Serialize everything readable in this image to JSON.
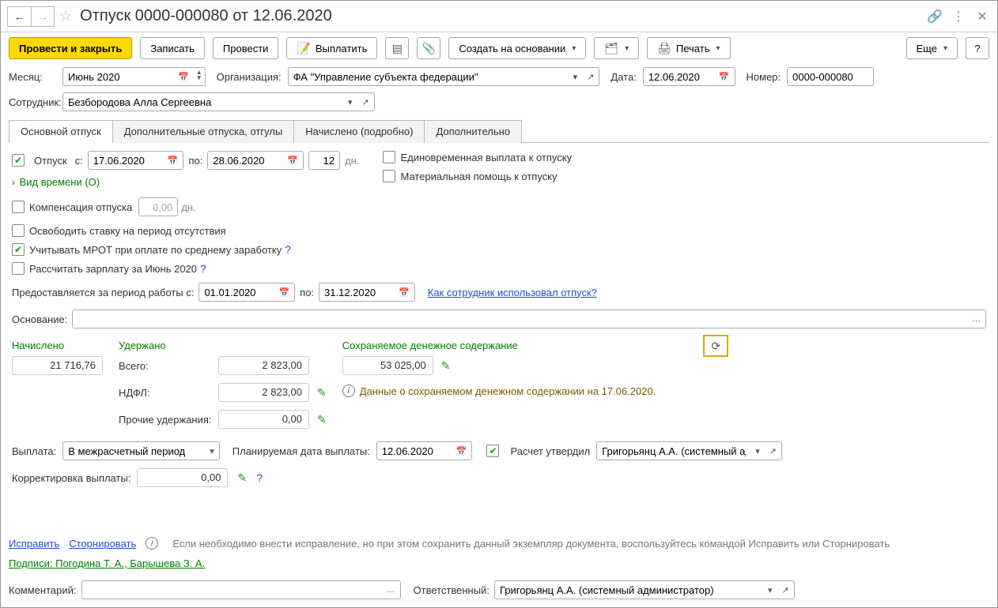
{
  "header": {
    "title": "Отпуск 0000-000080 от 12.06.2020"
  },
  "toolbar": {
    "post_close": "Провести и закрыть",
    "save": "Записать",
    "post": "Провести",
    "pay": "Выплатить",
    "create_based": "Создать на основании",
    "print": "Печать",
    "more": "Еще",
    "help": "?"
  },
  "form": {
    "month_label": "Месяц:",
    "month_value": "Июнь 2020",
    "org_label": "Организация:",
    "org_value": "ФА \"Управление субъекта федерации\"",
    "date_label": "Дата:",
    "date_value": "12.06.2020",
    "number_label": "Номер:",
    "number_value": "0000-000080",
    "employee_label": "Сотрудник:",
    "employee_value": "Безбородова Алла Сергеевна"
  },
  "tabs": {
    "main": "Основной отпуск",
    "additional": "Дополнительные отпуска, отгулы",
    "accrued": "Начислено (подробно)",
    "extra": "Дополнительно"
  },
  "main_tab": {
    "vacation_label": "Отпуск",
    "from_label": "с:",
    "from_date": "17.06.2020",
    "to_label": "по:",
    "to_date": "28.06.2020",
    "days": "12",
    "days_label": "дн.",
    "onetime_pay": "Единовременная выплата к отпуску",
    "mat_help": "Материальная помощь к отпуску",
    "time_kind": "Вид времени (О)",
    "compensation": "Компенсация отпуска",
    "comp_days": "0,00",
    "comp_days_label": "дн.",
    "release_rate": "Освободить ставку на период отсутствия",
    "mrot": "Учитывать МРОТ при оплате по среднему заработку",
    "calc_salary": "Рассчитать зарплату за Июнь 2020",
    "period_label": "Предоставляется за период работы с:",
    "period_from": "01.01.2020",
    "period_to_label": "по:",
    "period_to": "31.12.2020",
    "how_used": "Как сотрудник использовал отпуск?",
    "basis_label": "Основание:",
    "basis_value": "",
    "accrued_header": "Начислено",
    "accrued_value": "21 716,76",
    "held_header": "Удержано",
    "total_label": "Всего:",
    "total_value": "2 823,00",
    "ndfl_label": "НДФЛ:",
    "ndfl_value": "2 823,00",
    "other_held_label": "Прочие удержания:",
    "other_held_value": "0,00",
    "saved_header": "Сохраняемое денежное содержание",
    "saved_value": "53 025,00",
    "saved_info": "Данные о сохраняемом денежном содержании на 17.06.2020.",
    "payment_label": "Выплата:",
    "payment_value": "В межрасчетный период",
    "planned_date_label": "Планируемая дата выплаты:",
    "planned_date": "12.06.2020",
    "approved_label": "Расчет утвердил",
    "approved_by": "Григорьянц А.А. (системный адми",
    "correction_label": "Корректировка выплаты:",
    "correction_value": "0,00"
  },
  "footer": {
    "fix": "Исправить",
    "reverse": "Сторнировать",
    "note": "Если необходимо внести исправление, но при этом сохранить данный экземпляр документа, воспользуйтесь командой Исправить или Сторнировать",
    "signatures": "Подписи: Погодина Т. А., Барышева З. А.",
    "comment_label": "Комментарий:",
    "comment_value": "",
    "responsible_label": "Ответственный:",
    "responsible_value": "Григорьянц А.А. (системный администратор)"
  }
}
